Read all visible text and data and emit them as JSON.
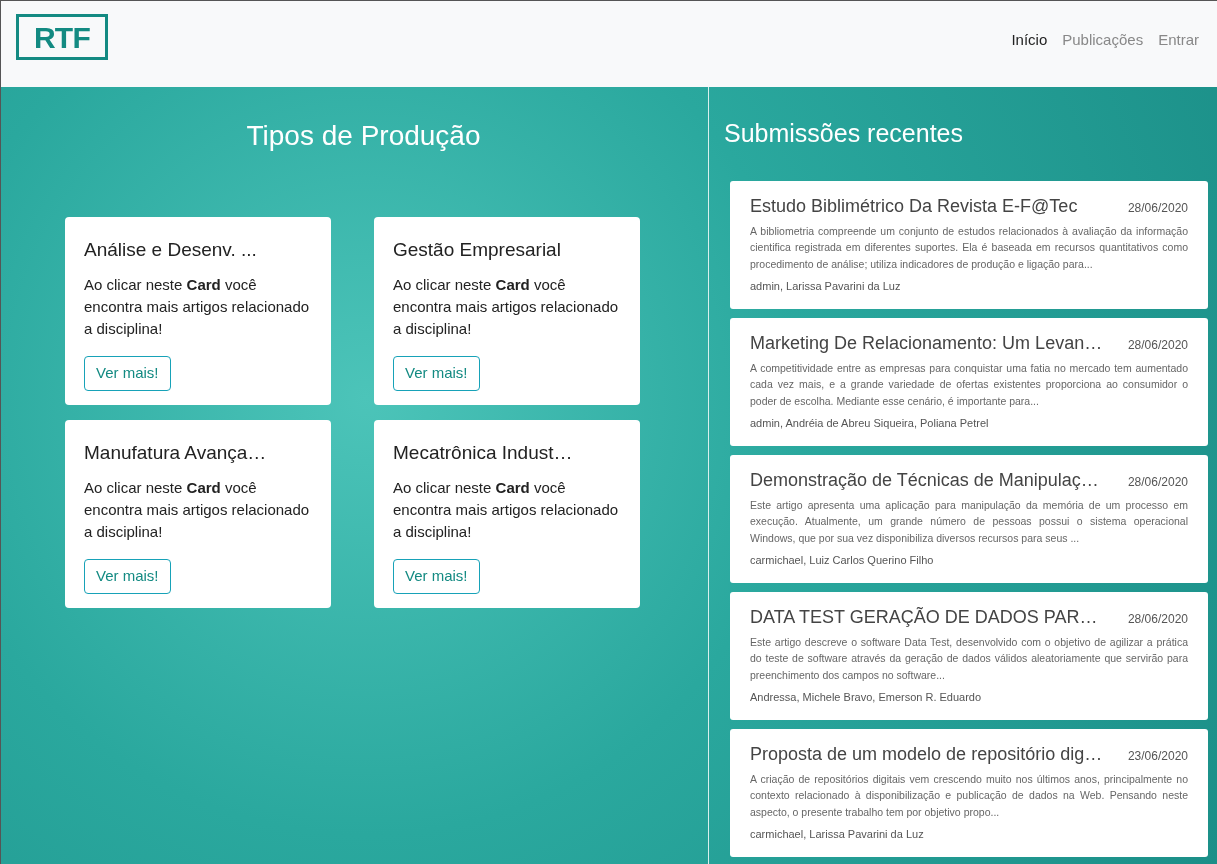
{
  "header": {
    "logo": "RTF",
    "nav": [
      {
        "label": "Início",
        "selected": true
      },
      {
        "label": "Publicações",
        "selected": false
      },
      {
        "label": "Entrar",
        "selected": false
      }
    ]
  },
  "production": {
    "title": "Tipos de Produção",
    "cards": [
      {
        "title": "Análise e Desenv. ...",
        "text": "Ao clicar neste **Card** você encontra mais artigos relacionado a disciplina!",
        "button": "Ver mais!"
      },
      {
        "title": "Gestão Empresarial",
        "text": "Ao clicar neste **Card** você encontra mais artigos relacionado a disciplina!",
        "button": "Ver mais!"
      },
      {
        "title": "Manufatura Avança…",
        "text": "Ao clicar neste **Card** você encontra mais artigos relacionado a disciplina!",
        "button": "Ver mais!"
      },
      {
        "title": "Mecatrônica Indust…",
        "text": "Ao clicar neste **Card** você encontra mais artigos relacionado a disciplina!",
        "button": "Ver mais!"
      }
    ]
  },
  "recent": {
    "title": "Submissões recentes",
    "items": [
      {
        "title": "Estudo Biblimétrico Da Revista E-F@Tec",
        "date": "28/06/2020",
        "abstract": "A bibliometria compreende um conjunto de estudos relacionados à avaliação da informação cientifica registrada em diferentes suportes. Ela é baseada em recursos quantitativos como procedimento de análise; utiliza indicadores de produção e ligação para...",
        "authors": "admin, Larissa Pavarini da Luz"
      },
      {
        "title": "Marketing De Relacionamento: Um Levan…",
        "date": "28/06/2020",
        "abstract": "A competitividade entre as empresas para conquistar uma fatia no mercado tem aumentado cada vez mais, e a grande variedade de ofertas existentes proporciona ao consumidor o poder de escolha. Mediante esse cenário, é importante para...",
        "authors": "admin, Andréia de Abreu Siqueira, Poliana Petrel"
      },
      {
        "title": "Demonstração de Técnicas de Manipulaç…",
        "date": "28/06/2020",
        "abstract": "Este artigo apresenta uma aplicação para manipulação da memória de um processo em execução. Atualmente, um grande número de pessoas possui o sistema operacional Windows, que por sua vez disponibiliza diversos recursos para seus ...",
        "authors": "carmichael, Luiz Carlos Querino Filho"
      },
      {
        "title": "DATA TEST GERAÇÃO DE DADOS PAR…",
        "date": "28/06/2020",
        "abstract": "Este artigo descreve o software Data Test, desenvolvido com o objetivo de agilizar a prática do teste de software através da geração de dados válidos aleatoriamente que servirão para preenchimento dos campos no software...",
        "authors": "Andressa, Michele Bravo, Emerson R. Eduardo"
      },
      {
        "title": "Proposta de um modelo de repositório dig…",
        "date": "23/06/2020",
        "abstract": "A criação de repositórios digitais vem crescendo muito nos últimos anos, principalmente no contexto relacionado à disponibilização e publicação de dados na Web. Pensando neste aspecto, o presente trabalho tem por objetivo propo...",
        "authors": "carmichael, Larissa Pavarini da Luz"
      }
    ]
  }
}
